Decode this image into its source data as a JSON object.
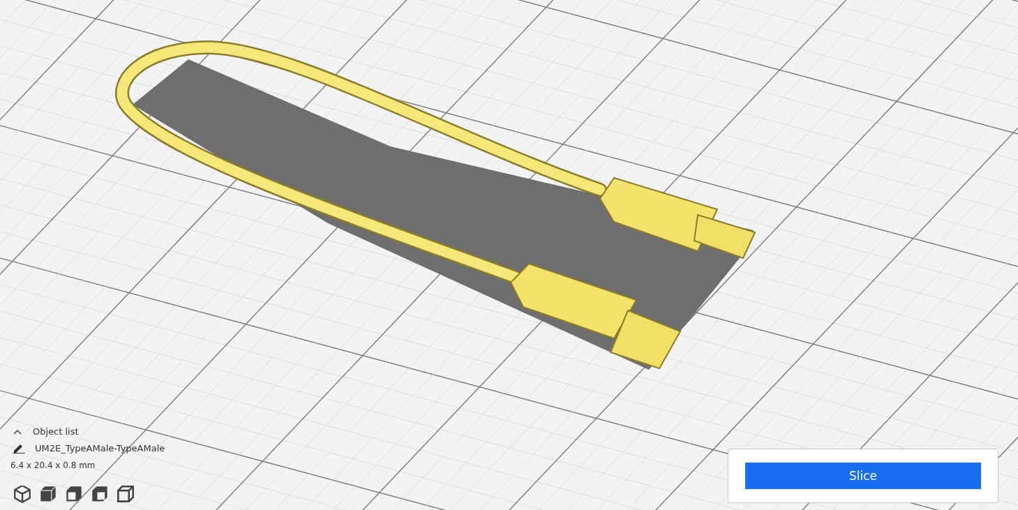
{
  "object_list": {
    "toggle_label": "Object list",
    "expanded": true,
    "object_name": "UM2E_TypeAMale-TypeAMale",
    "dimensions": "6.4 x 20.4 x 0.8 mm"
  },
  "view_buttons": [
    {
      "kind": "iso"
    },
    {
      "kind": "front"
    },
    {
      "kind": "top"
    },
    {
      "kind": "left"
    },
    {
      "kind": "right"
    }
  ],
  "slice_button": {
    "label": "Slice"
  }
}
